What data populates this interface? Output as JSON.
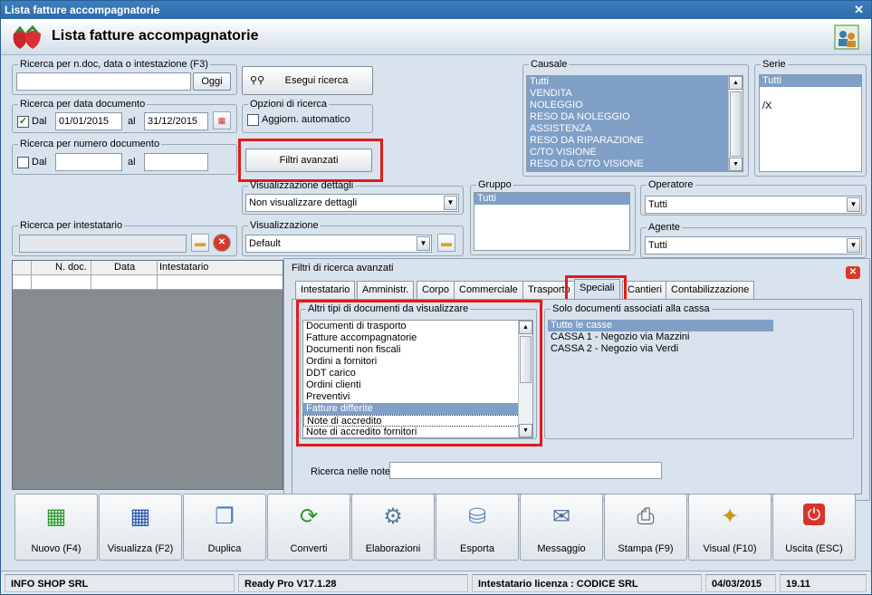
{
  "window": {
    "title": "Lista fatture accompagnatorie",
    "header_title": "Lista fatture accompagnatorie"
  },
  "search_text": {
    "legend": "Ricerca per n.doc, data o intestazione (F3)",
    "value": "",
    "today_button": "Oggi"
  },
  "search_button": "Esegui ricerca",
  "date_search": {
    "legend": "Ricerca per data documento",
    "from_label": "Dal",
    "from_value": "01/01/2015",
    "to_label": "al",
    "to_value": "31/12/2015",
    "from_checked": true
  },
  "number_search": {
    "legend": "Ricerca per numero documento",
    "from_label": "Dal",
    "to_label": "al",
    "from_value": "",
    "to_value": ""
  },
  "search_options": {
    "legend": "Opzioni di ricerca",
    "auto_update_label": "Aggiorn. automatico"
  },
  "advanced_filters_button": "Filtri avanzati",
  "details_view": {
    "legend": "Visualizzazione dettagli",
    "value": "Non visualizzare dettagli"
  },
  "holder_search": {
    "legend": "Ricerca per intestatario",
    "value": ""
  },
  "view": {
    "legend": "Visualizzazione",
    "value": "Default"
  },
  "causale": {
    "legend": "Causale",
    "items": [
      "Tutti",
      "VENDITA",
      "NOLEGGIO",
      "RESO DA NOLEGGIO",
      "ASSISTENZA",
      "RESO DA RIPARAZIONE",
      "C/TO VISIONE",
      "RESO DA C/TO VISIONE"
    ]
  },
  "serie": {
    "legend": "Serie",
    "items": [
      "Tutti",
      "",
      "/X"
    ]
  },
  "gruppo": {
    "legend": "Gruppo",
    "items": [
      "Tutti"
    ]
  },
  "operatore": {
    "legend": "Operatore",
    "value": "Tutti"
  },
  "agente": {
    "legend": "Agente",
    "value": "Tutti"
  },
  "grid": {
    "columns": [
      "N. doc.",
      "Data",
      "Intestatario"
    ]
  },
  "advanced": {
    "title": "Filtri di ricerca avanzati",
    "tabs": [
      "Intestatario",
      "Amministr.",
      "Corpo",
      "Commerciale",
      "Trasporto",
      "Speciali",
      "Cantieri",
      "Contabilizzazione"
    ],
    "active_tab": "Speciali",
    "doc_types": {
      "legend": "Altri tipi di documenti da visualizzare",
      "items": [
        "Documenti di trasporto",
        "Fatture accompagnatorie",
        "Documenti non fiscali",
        "Ordini a fornitori",
        "DDT carico",
        "Ordini clienti",
        "Preventivi",
        "Fatture differite",
        "Note di accredito",
        "Note di accredito fornitori"
      ],
      "selected": "Fatture differite"
    },
    "cassa": {
      "legend": "Solo documenti associati alla cassa",
      "items": [
        "Tutte le casse",
        "CASSA 1 - Negozio via Mazzini",
        "CASSA 2 - Negozio via Verdi"
      ],
      "selected": "Tutte le casse"
    },
    "notes_label": "Ricerca nelle note",
    "notes_value": ""
  },
  "toolbar": [
    "Nuovo (F4)",
    "Visualizza (F2)",
    "Duplica",
    "Converti",
    "Elaborazioni",
    "Esporta",
    "Messaggio",
    "Stampa (F9)",
    "Visual (F10)",
    "Uscita (ESC)"
  ],
  "status": {
    "company": "INFO SHOP SRL",
    "version": "Ready Pro V17.1.28",
    "license": "Intestatario licenza : CODICE SRL",
    "date": "04/03/2015",
    "time": "19.11"
  }
}
